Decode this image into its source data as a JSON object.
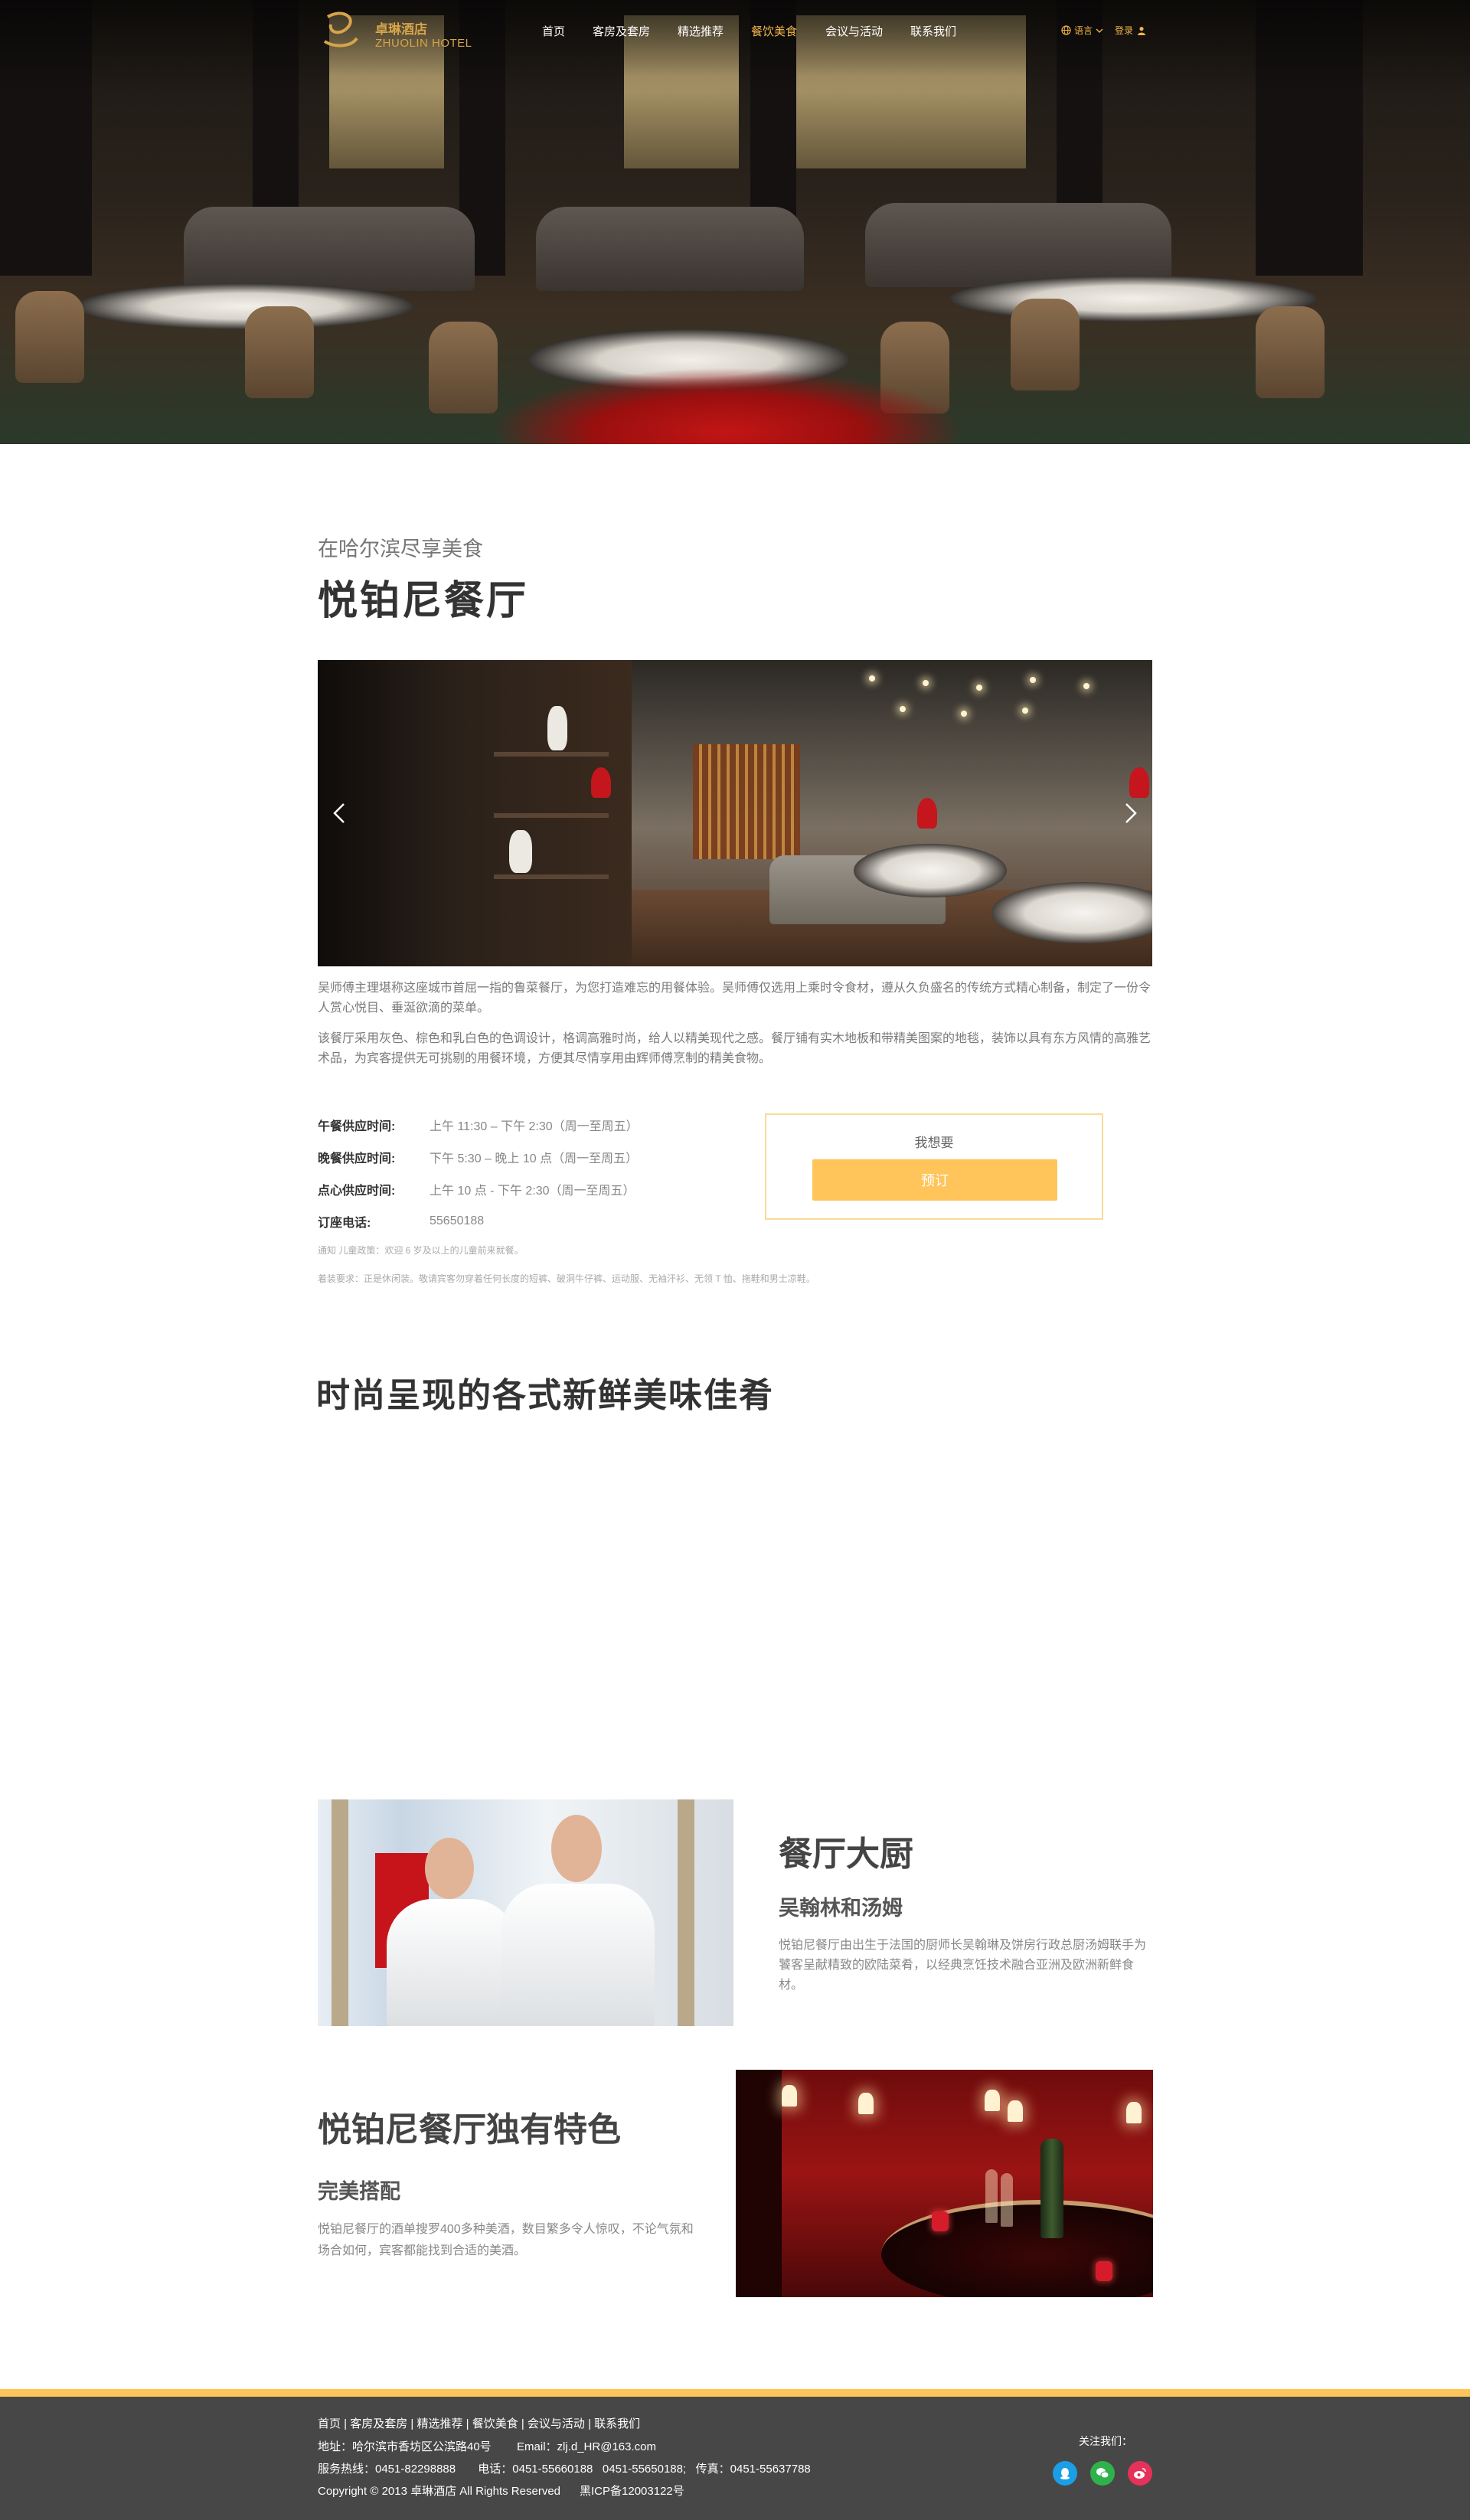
{
  "nav": {
    "logo_cn": "卓琳酒店",
    "logo_en": "ZHUOLIN HOTEL",
    "menu": [
      "首页",
      "客房及套房",
      "精选推荐",
      "餐饮美食",
      "会议与活动",
      "联系我们"
    ],
    "lang_label": "语言",
    "login_label": "登录",
    "active_item": "餐饮美食",
    "accent_color": "#f0b54a"
  },
  "intro": {
    "subtitle": "在哈尔滨尽享美食",
    "title": "悦铂尼餐厅"
  },
  "description": {
    "p1": "吴师傅主理堪称这座城市首屈一指的鲁菜餐厅，为您打造难忘的用餐体验。吴师傅仅选用上乘时令食材，遵从久负盛名的传统方式精心制备，制定了一份令人赏心悦目、垂涎欲滴的菜单。",
    "p2": "该餐厅采用灰色、棕色和乳白色的色调设计，格调高雅时尚，给人以精美现代之感。餐厅铺有实木地板和带精美图案的地毯，装饰以具有东方风情的高雅艺术品，为宾客提供无可挑剔的用餐环境，方便其尽情享用由辉师傅烹制的精美食物。"
  },
  "hours": {
    "rows": [
      {
        "label": "午餐供应时间:",
        "value": "上午 11:30 – 下午 2:30（周一至周五）"
      },
      {
        "label": "晚餐供应时间:",
        "value": "下午 5:30 – 晚上 10 点（周一至周五）"
      },
      {
        "label": "点心供应时间:",
        "value": "上午 10 点 - 下午 2:30（周一至周五）"
      },
      {
        "label": "订座电话:",
        "value": "55650188"
      }
    ]
  },
  "booking": {
    "prompt": "我想要",
    "button": "预订",
    "button_color": "#ffc55b"
  },
  "notes": {
    "n1": "通知 儿童政策：欢迎 6 岁及以上的儿童前来就餐。",
    "n2": "着装要求：正是休闲装。敬请宾客勿穿着任何长度的短裤、破洞牛仔裤、运动服、无袖汗衫、无领 T 恤、拖鞋和男士凉鞋。"
  },
  "section2": {
    "title": "时尚呈现的各式新鲜美味佳肴"
  },
  "chef": {
    "title": "餐厅大厨",
    "subtitle": "吴翰林和汤姆",
    "text": "悦铂尼餐厅由出生于法国的厨师长吴翰琳及饼房行政总厨汤姆联手为饕客呈献精致的欧陆菜肴，以经典烹饪技术融合亚洲及欧洲新鲜食材。"
  },
  "feature": {
    "title": "悦铂尼餐厅独有特色",
    "subtitle": "完美搭配",
    "text": "悦铂尼餐厅的酒单搜罗400多种美酒，数目繁多令人惊叹，不论气氛和场合如何，宾客都能找到合适的美酒。"
  },
  "footer": {
    "links": "首页 | 客房及套房 | 精选推荐 | 餐饮美食 | 会议与活动 | 联系我们",
    "address": "地址：哈尔滨市香坊区公滨路40号        Email：zlj.d_HR@163.com",
    "phones": "服务热线：0451-82298888       电话：0451-55660188   0451-55650188;   传真：0451-55637788",
    "copyright": "Copyright © 2013 卓琳酒店 All Rights Reserved      黑ICP备12003122号",
    "follow": "关注我们：",
    "social": [
      {
        "icon": "qq-icon",
        "color": "#1a9ee6"
      },
      {
        "icon": "wechat-icon",
        "color": "#2fb24c"
      },
      {
        "icon": "weibo-icon",
        "color": "#e6325a"
      }
    ]
  }
}
